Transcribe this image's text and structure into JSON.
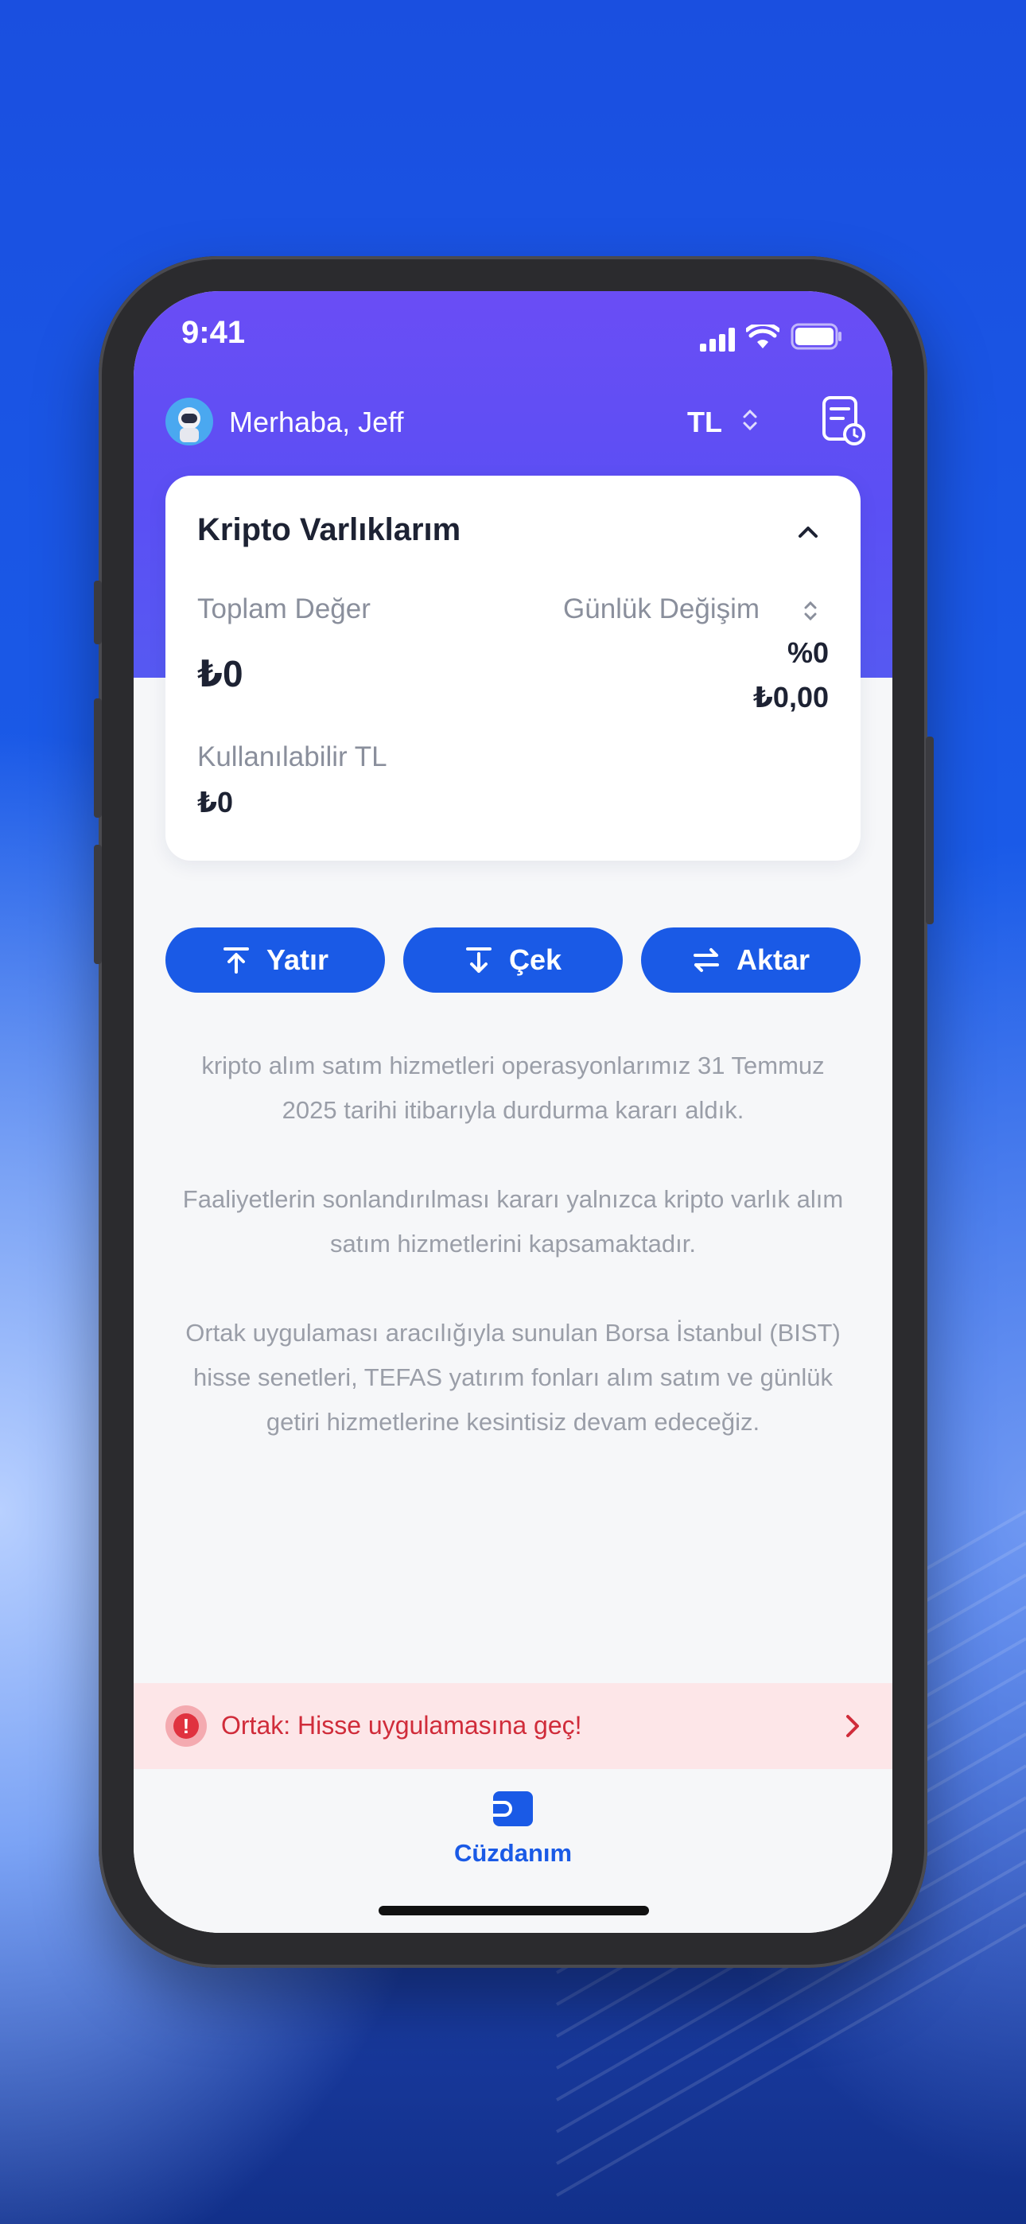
{
  "status_bar": {
    "time": "9:41"
  },
  "header": {
    "greeting": "Merhaba, Jeff",
    "currency": "TL",
    "icons": [
      "avatar-astronaut-icon",
      "currency-switch-icon",
      "history-receipt-icon"
    ]
  },
  "card": {
    "title": "Kripto Varlıklarım",
    "total_label": "Toplam Değer",
    "total_value": "₺0",
    "daily_change_label": "Günlük Değişim",
    "daily_change_percent": "%0",
    "daily_change_amount": "₺0,00",
    "available_label": "Kullanılabilir TL",
    "available_value": "₺0"
  },
  "actions": [
    {
      "label": "Yatır",
      "icon": "deposit-arrow-up-icon"
    },
    {
      "label": "Çek",
      "icon": "withdraw-arrow-down-icon"
    },
    {
      "label": "Aktar",
      "icon": "transfer-arrows-icon"
    }
  ],
  "notice": {
    "p1_line1": "kripto alım satım hizmetleri operasyonlarımız 31 Temmuz",
    "p1_line2": "2025 tarihi itibarıyla durdurma kararı aldık.",
    "p2_line1": "Faaliyetlerin sonlandırılması kararı yalnızca kripto varlık alım",
    "p2_line2": "satım hizmetlerini kapsamaktadır.",
    "p3_line1": "Ortak uygulaması aracılığıyla sunulan Borsa İstanbul (BIST)",
    "p3_line2": "hisse senetleri, TEFAS yatırım fonları alım satım ve günlük",
    "p3_line3": "getiri hizmetlerine kesintisiz devam edeceğiz."
  },
  "banner": {
    "text": "Ortak: Hisse uygulamasına geç!",
    "icon": "alert-exclamation-icon"
  },
  "tab_bar": {
    "label": "Cüzdanım",
    "icon": "wallet-icon"
  },
  "colors": {
    "primary": "#1a5ae6",
    "header_purple": "#5b4ff4",
    "alert_red": "#d02c3a",
    "alert_bg": "#fde6e8"
  }
}
